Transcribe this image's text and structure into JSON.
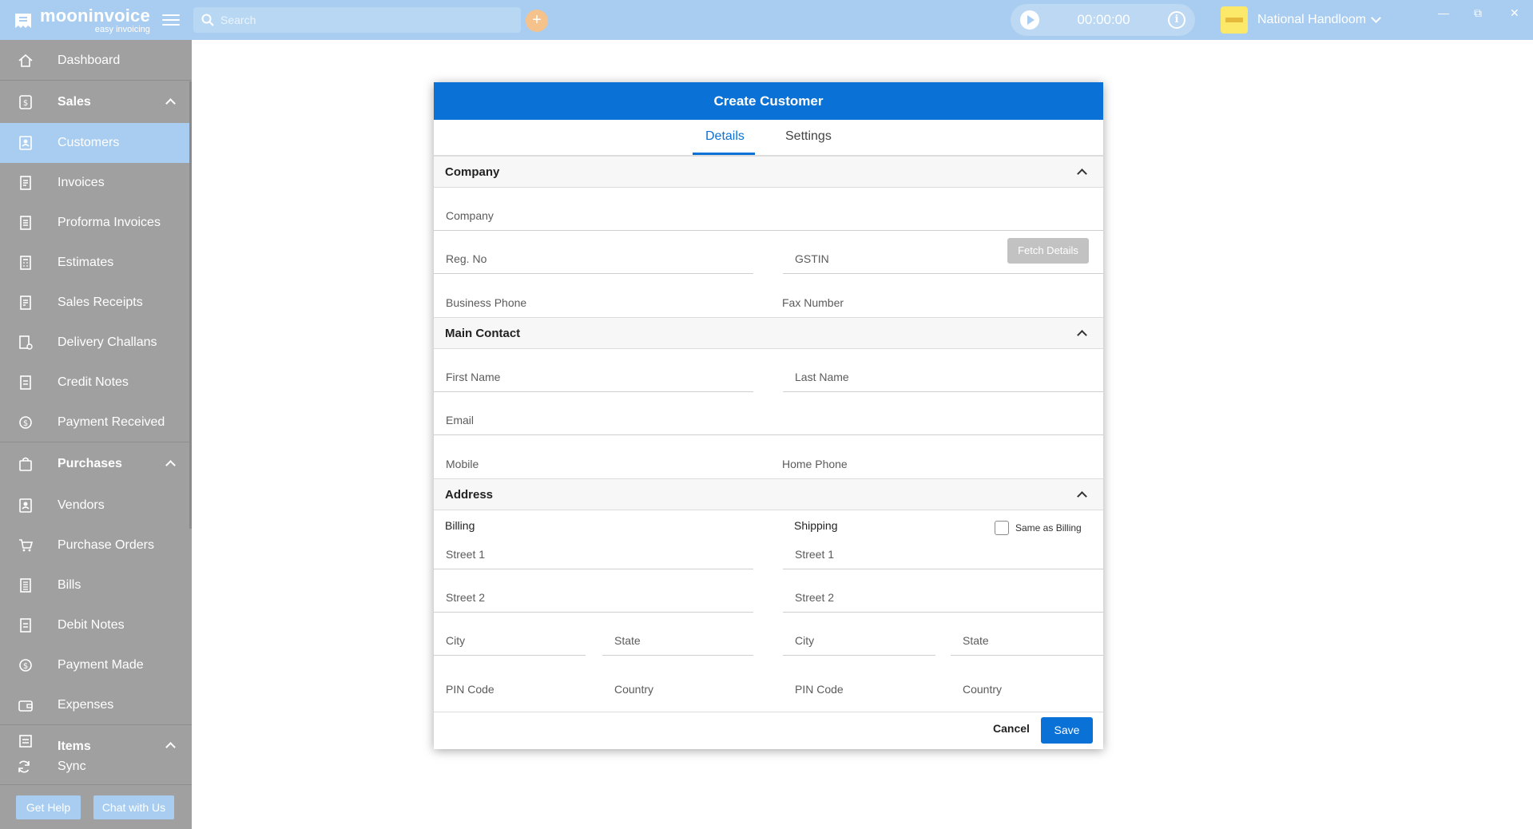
{
  "app": {
    "brand_name": "mooninvoice",
    "brand_tagline": "easy invoicing",
    "search_placeholder": "Search",
    "add_symbol": "+",
    "timer": "00:00:00",
    "info_symbol": "i",
    "company_name": "National Handloom",
    "window_controls": {
      "minimize": "—",
      "restore": "⧉",
      "close": "✕"
    }
  },
  "sidebar": {
    "dashboard": "Dashboard",
    "sales_section": "Sales",
    "sales_items": [
      "Customers",
      "Invoices",
      "Proforma Invoices",
      "Estimates",
      "Sales Receipts",
      "Delivery Challans",
      "Credit Notes",
      "Payment Received"
    ],
    "active_item": "Customers",
    "purchases_section": "Purchases",
    "purchase_items": [
      "Vendors",
      "Purchase Orders",
      "Bills",
      "Debit Notes",
      "Payment Made",
      "Expenses"
    ],
    "items_section": "Items",
    "sync": "Sync",
    "get_help": "Get Help",
    "chat": "Chat with Us"
  },
  "dialog": {
    "title": "Create Customer",
    "tabs": [
      "Details",
      "Settings"
    ],
    "active_tab": "Details",
    "company_section": "Company",
    "company_fields": {
      "company": "Company",
      "reg_no": "Reg. No",
      "gstin": "GSTIN",
      "business_phone": "Business Phone",
      "fax": "Fax Number"
    },
    "fetch_details": "Fetch Details",
    "contact_section": "Main Contact",
    "contact_fields": {
      "first_name": "First Name",
      "last_name": "Last Name",
      "email": "Email",
      "mobile": "Mobile",
      "home_phone": "Home Phone"
    },
    "address_section": "Address",
    "billing_label": "Billing",
    "shipping_label": "Shipping",
    "same_as_billing": "Same as Billing",
    "address_fields": {
      "street1": "Street 1",
      "street2": "Street 2",
      "city": "City",
      "state": "State",
      "pin": "PIN Code",
      "country": "Country"
    },
    "cancel": "Cancel",
    "save": "Save"
  },
  "colors": {
    "topbar": "#a8cdf0",
    "sidebar": "#a0a0a0",
    "primary": "#0a72d6",
    "add_button": "#f6c28b"
  }
}
